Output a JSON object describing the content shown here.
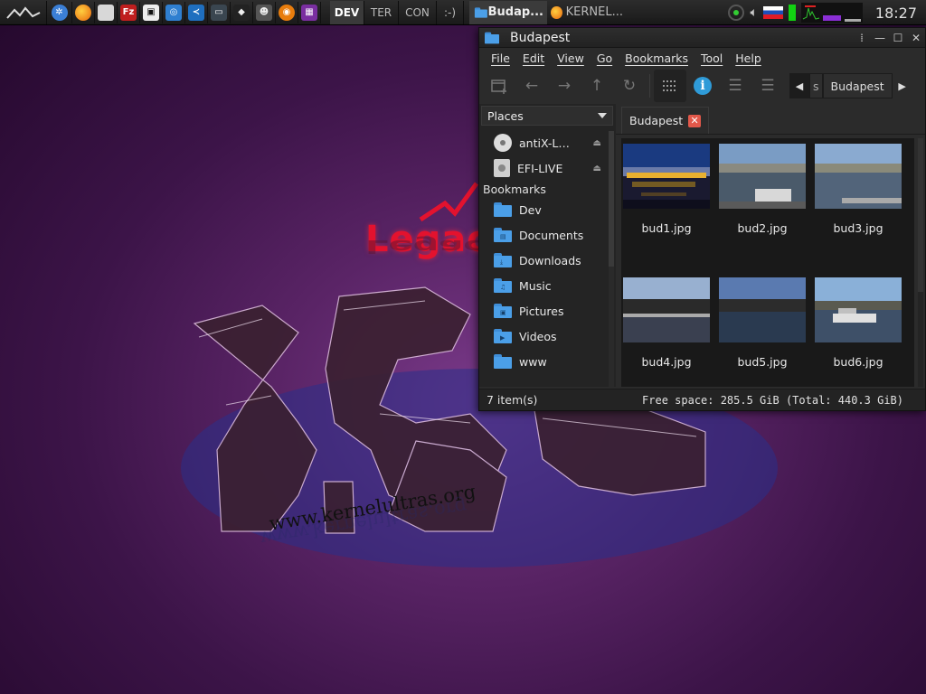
{
  "taskbar": {
    "desktops": [
      "DEV",
      "TER",
      "CON",
      ":-)"
    ],
    "active_desktop": "DEV",
    "launchers": [
      "globe-icon",
      "firefox-icon",
      "files-icon",
      "filezilla-icon",
      "terminal-icon",
      "screenshot-icon",
      "vscode-icon",
      "console-icon",
      "inkscape-icon",
      "gimp-icon",
      "blender-icon",
      "app-icon"
    ],
    "tasks": [
      {
        "label": "Budap...",
        "active": true
      },
      {
        "label": "KERNEL...",
        "active": false
      }
    ],
    "clock": "18:27"
  },
  "wallpaper": {
    "brand_text": "Legac",
    "url_text": "www.kernelultras.org"
  },
  "window": {
    "title": "Budapest",
    "menu": [
      "File",
      "Edit",
      "View",
      "Go",
      "Bookmarks",
      "Tool",
      "Help"
    ],
    "path_partial": "s",
    "path_current": "Budapest",
    "side": {
      "dropdown_label": "Places",
      "devices": [
        {
          "label": "antiX-L…",
          "icon": "cdrom-icon"
        },
        {
          "label": "EFI-LIVE",
          "icon": "harddisk-icon"
        }
      ],
      "bookmarks_header": "Bookmarks",
      "bookmarks": [
        {
          "label": "Dev",
          "emblem": ""
        },
        {
          "label": "Documents",
          "emblem": "▤"
        },
        {
          "label": "Downloads",
          "emblem": "⤓"
        },
        {
          "label": "Music",
          "emblem": "♫"
        },
        {
          "label": "Pictures",
          "emblem": "▣"
        },
        {
          "label": "Videos",
          "emblem": "▶"
        },
        {
          "label": "www",
          "emblem": ""
        }
      ]
    },
    "tab_label": "Budapest",
    "files": [
      {
        "name": "bud1.jpg",
        "scene": "night"
      },
      {
        "name": "bud2.jpg",
        "scene": "day1"
      },
      {
        "name": "bud3.jpg",
        "scene": "day2"
      },
      {
        "name": "bud4.jpg",
        "scene": "day3"
      },
      {
        "name": "bud5.jpg",
        "scene": "day4"
      },
      {
        "name": "bud6.jpg",
        "scene": "day5"
      }
    ],
    "status": {
      "items": "7 item(s)",
      "free_space": "Free space: 285.5 GiB (Total: 440.3 GiB)"
    }
  },
  "colors": {
    "accent": "#2f9bd8",
    "folder": "#4b9fe8",
    "tab_close": "#e2584a",
    "wallpaper_red": "#e3122e"
  }
}
